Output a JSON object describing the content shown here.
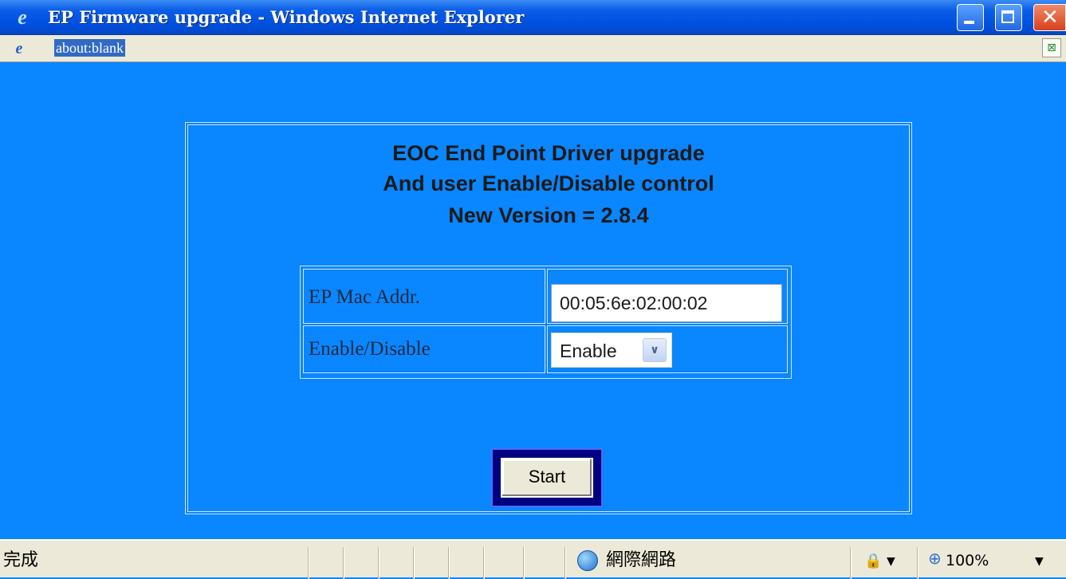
{
  "window": {
    "title": "EP Firmware upgrade - Windows Internet Explorer",
    "minimize_glyph": "",
    "maximize_glyph": "",
    "close_glyph": "✕"
  },
  "address_bar": {
    "url": "about:blank"
  },
  "page": {
    "heading_line1": "EOC End Point Driver upgrade",
    "heading_line2": "And user Enable/Disable control",
    "heading_line3": "New Version = 2.8.4",
    "form": {
      "mac_label": "EP Mac Addr.",
      "mac_value": "00:05:6e:02:00:02",
      "enable_label": "Enable/Disable",
      "enable_selected": "Enable"
    },
    "start_button": "Start"
  },
  "status_bar": {
    "status": "完成",
    "zone": "網際網路",
    "zoom": "100%"
  },
  "icons": {
    "title": "ie-logo-icon",
    "page": "ie-page-icon",
    "compat": "compatibility-view-icon",
    "zone": "globe-icon",
    "security": "lock-icon",
    "zoom": "zoom-icon"
  },
  "colors": {
    "page_background": "#0a86ff",
    "titlebar": "#0050e0",
    "address_highlight": "#316ac5",
    "start_frame": "#000080"
  }
}
